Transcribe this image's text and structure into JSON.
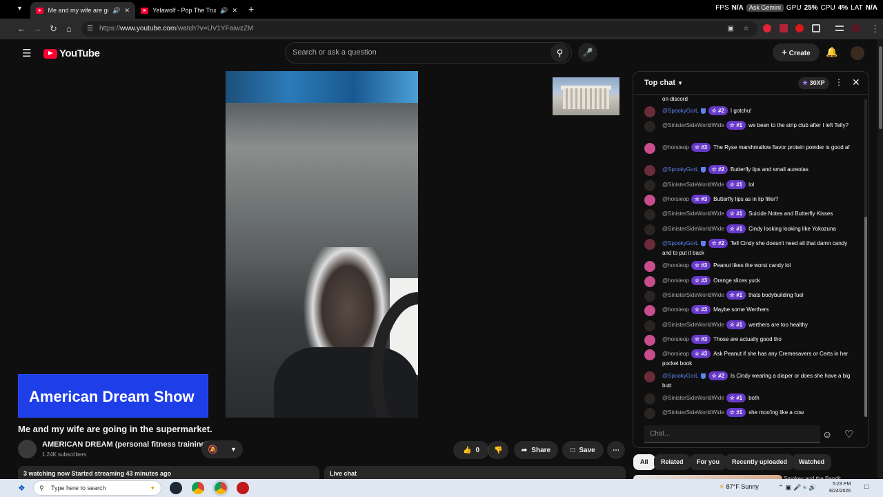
{
  "browser": {
    "tabs": [
      {
        "title": "Me and my wife are going",
        "active": true
      },
      {
        "title": "Yelawolf - Pop The Trunk - \\",
        "active": false
      }
    ],
    "new_tab": "+",
    "perf": {
      "fps_label": "FPS",
      "fps": "N/A",
      "gpu_label": "GPU",
      "gpu": "25%",
      "cpu_label": "CPU",
      "cpu": "4%",
      "lat_label": "LAT",
      "lat": "N/A",
      "overlay": "Ask Gemini"
    },
    "url_prefix": "https://",
    "url_host": "www.youtube.com",
    "url_path": "/watch?v=UV1YFaiwzZM"
  },
  "youtube": {
    "logo_text": "YouTube",
    "search_placeholder": "Search or ask a question",
    "create_label": "Create"
  },
  "player": {
    "banner_text": "American Dream Show"
  },
  "video": {
    "title": "Me and my wife are going in the supermarket.",
    "channel_name": "AMERICAN DREAM (personal fitness training)",
    "subscribers": "1.24K subscribers",
    "likes": "0",
    "share_label": "Share",
    "save_label": "Save",
    "status": "3 watching now  Started streaming 43 minutes ago",
    "live_chat_label": "Live chat"
  },
  "chat": {
    "title": "Top chat",
    "xp": "30XP",
    "input_placeholder": "Chat...",
    "messages": [
      {
        "user": "",
        "rank": "",
        "text": "on discord",
        "av": "#444"
      },
      {
        "user": "@SpookyGorL",
        "mod": true,
        "rank": "#2",
        "text": "I gotchu!",
        "av": "#6b2c3a"
      },
      {
        "user": "@SinisterSideWorldWide",
        "rank": "#1",
        "text": "we been to the strip club after I left Telly?",
        "av": "#2a2522"
      },
      {
        "user": "@horsieop",
        "rank": "#3",
        "text": "The Ryse marshmallow flavor protein powder is good af",
        "av": "#c74d8c"
      },
      {
        "user": "@SpookyGorL",
        "mod": true,
        "rank": "#2",
        "text": "Butterfly lips and small aureolas",
        "av": "#6b2c3a"
      },
      {
        "user": "@SinisterSideWorldWide",
        "rank": "#1",
        "text": "lol",
        "av": "#2a2522"
      },
      {
        "user": "@horsieop",
        "rank": "#3",
        "text": "Butterfly lips as in lip filler?",
        "av": "#c74d8c"
      },
      {
        "user": "@SinisterSideWorldWide",
        "rank": "#1",
        "text": "Suicide Notes and Butterfly Kisses",
        "av": "#2a2522"
      },
      {
        "user": "@SinisterSideWorldWide",
        "rank": "#1",
        "text": "Cindy looking looking like Yokozuna",
        "av": "#2a2522"
      },
      {
        "user": "@SpookyGorL",
        "mod": true,
        "rank": "#2",
        "text": "Tell Cindy she doesn't need all that damn candy and to put it back",
        "av": "#6b2c3a"
      },
      {
        "user": "@horsieop",
        "rank": "#3",
        "text": "Peanut likes the worst candy lol",
        "av": "#c74d8c"
      },
      {
        "user": "@horsieop",
        "rank": "#3",
        "text": "Orange slices yuck",
        "av": "#c74d8c"
      },
      {
        "user": "@SinisterSideWorldWide",
        "rank": "#1",
        "text": "thats bodybuilding fuel",
        "av": "#2a2522"
      },
      {
        "user": "@horsieop",
        "rank": "#3",
        "text": "Maybe some Werthers",
        "av": "#c74d8c"
      },
      {
        "user": "@SinisterSideWorldWide",
        "rank": "#1",
        "text": "werthers are too healthy",
        "av": "#2a2522"
      },
      {
        "user": "@horsieop",
        "rank": "#3",
        "text": "Those are actually good tho",
        "av": "#c74d8c"
      },
      {
        "user": "@horsieop",
        "rank": "#3",
        "text": "Ask Peanut if she has any Cremesavers or Certs in her pocket book",
        "av": "#c74d8c"
      },
      {
        "user": "@SpookyGorL",
        "mod": true,
        "rank": "#2",
        "text": "Is Cindy wearing a diaper or does she have a big butt",
        "av": "#6b2c3a"
      },
      {
        "user": "@SinisterSideWorldWide",
        "rank": "#1",
        "text": "both",
        "av": "#2a2522"
      },
      {
        "user": "@SinisterSideWorldWide",
        "rank": "#1",
        "text": "she moo'ing like a cow",
        "av": "#2a2522"
      }
    ]
  },
  "chips": [
    "All",
    "Related",
    "For you",
    "Recently uploaded",
    "Watched"
  ],
  "side_video_title": "Smokey and the Bandit",
  "taskbar": {
    "search_placeholder": "Type here to search",
    "weather": "87°F  Sunny",
    "time": "5:23 PM",
    "date": "8/24/2026"
  },
  "colors": {
    "brand": "#ff0033",
    "chat_rank": "#6639c9",
    "banner": "#1e3ee8",
    "mod_name": "#5e84f1"
  }
}
